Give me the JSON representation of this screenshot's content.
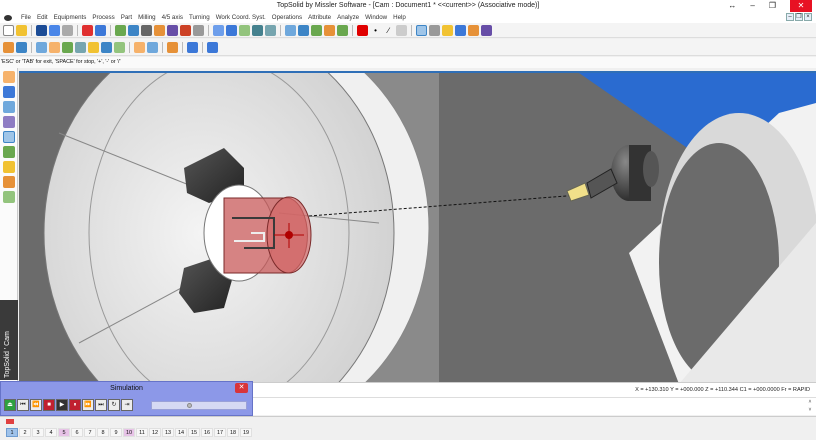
{
  "window": {
    "title": "TopSolid by Missler Software - [Cam : Document1 *   <<current>> (Associative mode)]",
    "controls": [
      "↔",
      "–",
      "❐",
      "✕"
    ]
  },
  "menu": [
    "File",
    "Edit",
    "Equipments",
    "Process",
    "Part",
    "Milling",
    "4/5 axis",
    "Turning",
    "Work Coord. Syst.",
    "Operations",
    "Attribute",
    "Analyze",
    "Window",
    "Help"
  ],
  "hint": "'ESC' or 'TAB' for exit, 'SPACE' for stop, '+', '-' or '/'",
  "status": {
    "coords": "X = +130.310  Y = +000.000  Z = +110.344  C1 = +000.0000  Fr = RAPID"
  },
  "side_label": "TopSolid ' Cam",
  "simulation": {
    "title": "Simulation",
    "close": "✕",
    "buttons": [
      "⏏",
      "⏮",
      "⏪",
      "■",
      "▶",
      "⏸",
      "⏩",
      "⏭",
      "↻",
      "⇥"
    ],
    "slider_value": 0.4
  },
  "pages": [
    "1",
    "2",
    "3",
    "4",
    "5",
    "6",
    "7",
    "8",
    "9",
    "10",
    "11",
    "12",
    "13",
    "14",
    "15",
    "16",
    "17",
    "18",
    "19"
  ],
  "active_pages": [
    "1",
    "5",
    "10"
  ],
  "colors": {
    "accent": "#2f6fb7",
    "background_3d": "#6b6b6b",
    "part": "#c85a5a",
    "blue_plane": "#2a6bd0",
    "sim_panel": "#8c98e8"
  }
}
